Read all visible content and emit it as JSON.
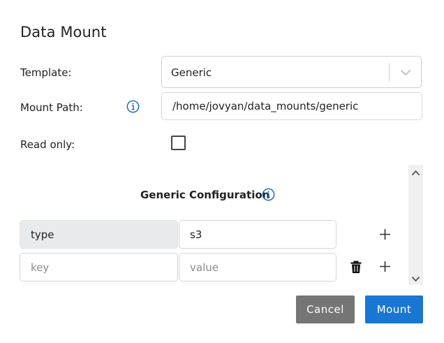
{
  "dialog": {
    "title": "Data Mount"
  },
  "form": {
    "template_label": "Template:",
    "template_value": "Generic",
    "mount_path_label": "Mount Path:",
    "mount_path_value": "/home/jovyan/data_mounts/generic",
    "read_only_label": "Read only:",
    "read_only_checked": false
  },
  "config": {
    "heading": "Generic Configuration",
    "rows": [
      {
        "key": "type",
        "value": "s3",
        "key_placeholder": "key",
        "value_placeholder": "value"
      },
      {
        "key": "",
        "value": "",
        "key_placeholder": "key",
        "value_placeholder": "value"
      }
    ]
  },
  "buttons": {
    "cancel": "Cancel",
    "mount": "Mount"
  },
  "colors": {
    "primary": "#1976d2",
    "secondary": "#757575",
    "info_icon": "#1565c0"
  },
  "icons": {
    "info": "info-circle-icon",
    "add": "plus-icon",
    "delete": "trash-icon",
    "dropdown": "chevron-down-icon",
    "scroll_up": "chevron-up-icon",
    "scroll_down": "chevron-down-icon"
  }
}
